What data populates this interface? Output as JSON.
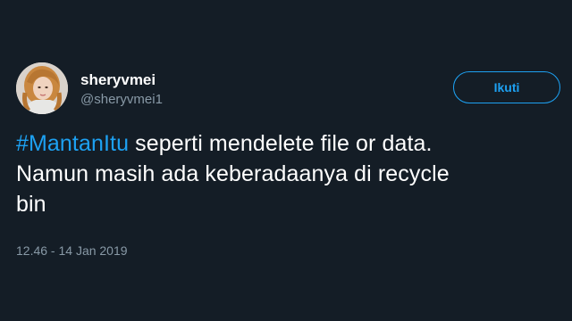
{
  "user": {
    "display_name": "sheryvmei",
    "handle": "@sheryvmei1"
  },
  "follow_button": {
    "label": "Ikuti"
  },
  "tweet": {
    "hashtag": "#MantanItu",
    "line1_rest": " seperti mendelete file or data.",
    "line2": "Namun masih ada keberadaanya di recycle",
    "line3": "bin",
    "timestamp": "12.46 - 14 Jan 2019"
  },
  "colors": {
    "background": "#141d26",
    "accent": "#1da1f2",
    "secondary_text": "#8899a6"
  }
}
